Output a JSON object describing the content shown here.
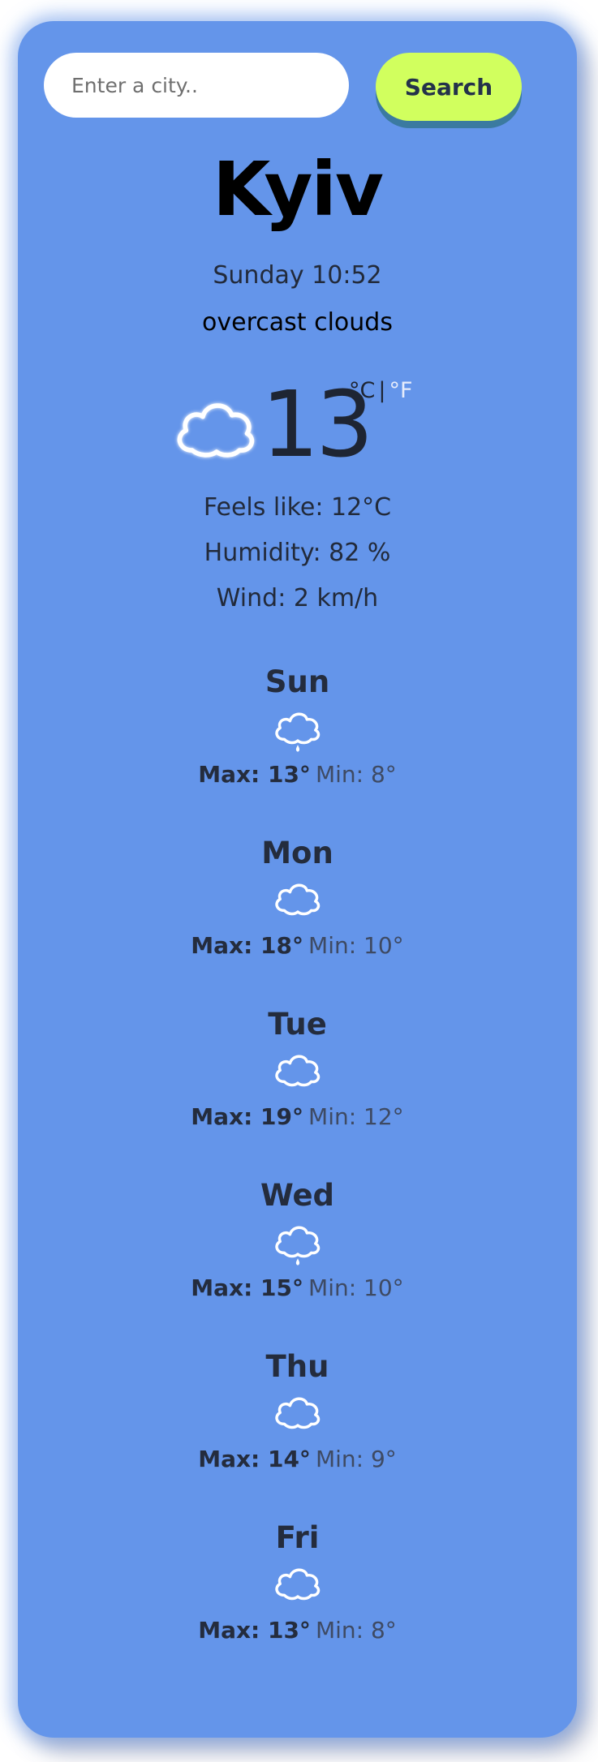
{
  "search": {
    "placeholder": "Enter a city..",
    "value": "",
    "button_label": "Search"
  },
  "current": {
    "city": "Kyiv",
    "datetime": "Sunday 10:52",
    "description": "overcast clouds",
    "icon": "cloud-icon",
    "temperature": "13",
    "unit_celsius": "°C",
    "unit_separator": "|",
    "unit_fahrenheit": "°F",
    "feels_like": "Feels like: 12°C",
    "humidity": "Humidity: 82 %",
    "wind": "Wind: 2 km/h"
  },
  "forecast": [
    {
      "day": "Sun",
      "icon": "cloud-rain-icon",
      "max": "Max: 13°",
      "min": "Min: 8°"
    },
    {
      "day": "Mon",
      "icon": "cloud-icon",
      "max": "Max: 18°",
      "min": "Min: 10°"
    },
    {
      "day": "Tue",
      "icon": "cloud-icon",
      "max": "Max: 19°",
      "min": "Min: 12°"
    },
    {
      "day": "Wed",
      "icon": "cloud-rain-icon",
      "max": "Max: 15°",
      "min": "Min: 10°"
    },
    {
      "day": "Thu",
      "icon": "cloud-icon",
      "max": "Max: 14°",
      "min": "Min: 9°"
    },
    {
      "day": "Fri",
      "icon": "cloud-icon",
      "max": "Max: 13°",
      "min": "Min: 8°"
    }
  ],
  "colors": {
    "card_background": "#6495ea",
    "search_button": "#d1ff5e",
    "button_shadow": "#3b7aa0",
    "inactive_unit": "#e6ecfb"
  }
}
